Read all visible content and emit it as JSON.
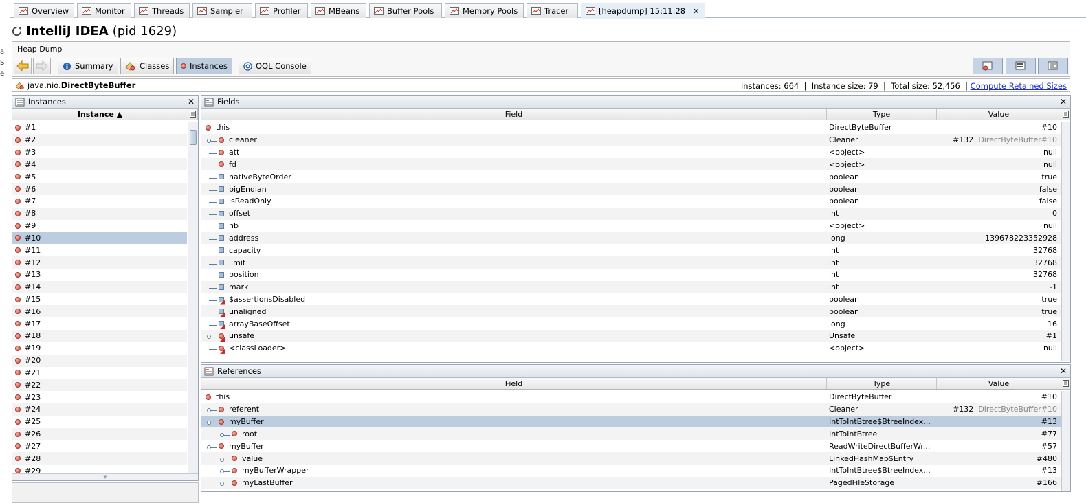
{
  "tabs": [
    {
      "label": "Overview",
      "icon": "overview-icon"
    },
    {
      "label": "Monitor",
      "icon": "monitor-icon"
    },
    {
      "label": "Threads",
      "icon": "threads-icon"
    },
    {
      "label": "Sampler",
      "icon": "sampler-icon"
    },
    {
      "label": "Profiler",
      "icon": "profiler-icon"
    },
    {
      "label": "MBeans",
      "icon": "mbeans-icon"
    },
    {
      "label": "Buffer Pools",
      "icon": "buffer-pools-icon"
    },
    {
      "label": "Memory Pools",
      "icon": "memory-pools-icon"
    },
    {
      "label": "Tracer",
      "icon": "tracer-icon"
    },
    {
      "label": "[heapdump] 15:11:28",
      "icon": "heapdump-icon",
      "active": true
    }
  ],
  "left_strip": [
    "a",
    "S",
    "e"
  ],
  "app": {
    "name": "IntelliJ IDEA",
    "pid": "(pid 1629)"
  },
  "heapdump_label": "Heap Dump",
  "views": [
    {
      "label": "Summary",
      "icon": "info-icon"
    },
    {
      "label": "Classes",
      "icon": "classes-icon"
    },
    {
      "label": "Instances",
      "icon": "instance-icon",
      "active": true
    },
    {
      "label": "OQL Console",
      "icon": "oql-icon"
    }
  ],
  "class_bar": {
    "package": "java.nio.",
    "class": "DirectByteBuffer",
    "stats": "Instances: 664  |  Instance size: 79  |  Total size: 52,456  |",
    "link": "Compute Retained Sizes"
  },
  "instances_panel": {
    "title": "Instances",
    "column": "Instance ▲",
    "items": [
      "#1",
      "#2",
      "#3",
      "#4",
      "#5",
      "#6",
      "#7",
      "#8",
      "#9",
      "#10",
      "#11",
      "#12",
      "#13",
      "#14",
      "#15",
      "#16",
      "#17",
      "#18",
      "#19",
      "#20",
      "#21",
      "#22",
      "#23",
      "#24",
      "#25",
      "#26",
      "#27",
      "#28",
      "#29"
    ],
    "selected_index": 9
  },
  "fields_panel": {
    "title": "Fields",
    "columns": [
      "Field",
      "Type",
      "Value"
    ],
    "rows": [
      {
        "name": "this",
        "type": "DirectByteBuffer",
        "value": "#10",
        "icon": "dot",
        "indent": 0
      },
      {
        "name": "cleaner",
        "type": "Cleaner",
        "value": "#132",
        "value_extra": "DirectByteBuffer#10",
        "icon": "dot",
        "indent": 1,
        "expand": true
      },
      {
        "name": "att",
        "type": "<object>",
        "value": "null",
        "icon": "dot",
        "indent": 1
      },
      {
        "name": "fd",
        "type": "<object>",
        "value": "null",
        "icon": "dot",
        "indent": 1
      },
      {
        "name": "nativeByteOrder",
        "type": "boolean",
        "value": "true",
        "icon": "sq",
        "indent": 1
      },
      {
        "name": "bigEndian",
        "type": "boolean",
        "value": "false",
        "icon": "sq",
        "indent": 1
      },
      {
        "name": "isReadOnly",
        "type": "boolean",
        "value": "false",
        "icon": "sq",
        "indent": 1
      },
      {
        "name": "offset",
        "type": "int",
        "value": "0",
        "icon": "sq",
        "indent": 1
      },
      {
        "name": "hb",
        "type": "<object>",
        "value": "null",
        "icon": "sq",
        "indent": 1
      },
      {
        "name": "address",
        "type": "long",
        "value": "139678223352928",
        "icon": "sq",
        "indent": 1
      },
      {
        "name": "capacity",
        "type": "int",
        "value": "32768",
        "icon": "sq",
        "indent": 1
      },
      {
        "name": "limit",
        "type": "int",
        "value": "32768",
        "icon": "sq",
        "indent": 1
      },
      {
        "name": "position",
        "type": "int",
        "value": "32768",
        "icon": "sq",
        "indent": 1
      },
      {
        "name": "mark",
        "type": "int",
        "value": "-1",
        "icon": "sq",
        "indent": 1
      },
      {
        "name": "$assertionsDisabled",
        "type": "boolean",
        "value": "true",
        "icon": "sq-static",
        "indent": 1
      },
      {
        "name": "unaligned",
        "type": "boolean",
        "value": "true",
        "icon": "sq-static",
        "indent": 1
      },
      {
        "name": "arrayBaseOffset",
        "type": "long",
        "value": "16",
        "icon": "sq-static",
        "indent": 1
      },
      {
        "name": "unsafe",
        "type": "Unsafe",
        "value": "#1",
        "icon": "dot-static",
        "indent": 1,
        "expand": true
      },
      {
        "name": "<classLoader>",
        "type": "<object>",
        "value": "null",
        "icon": "dot-static",
        "indent": 1
      }
    ]
  },
  "references_panel": {
    "title": "References",
    "columns": [
      "Field",
      "Type",
      "Value"
    ],
    "rows": [
      {
        "name": "this",
        "type": "DirectByteBuffer",
        "value": "#10",
        "indent": 0
      },
      {
        "name": "referent",
        "type": "Cleaner",
        "value": "#132",
        "value_extra": "DirectByteBuffer#10",
        "indent": 1,
        "expand": true
      },
      {
        "name": "myBuffer",
        "type": "IntToIntBtree$BtreeIndex...",
        "value": "#13",
        "indent": 1,
        "expand": true,
        "expanded": true,
        "selected": true
      },
      {
        "name": "root",
        "type": "IntToIntBtree",
        "value": "#77",
        "indent": 2,
        "expand": true
      },
      {
        "name": "myBuffer",
        "type": "ReadWriteDirectBufferWr...",
        "value": "#57",
        "indent": 1,
        "expand": true,
        "expanded": true
      },
      {
        "name": "value",
        "type": "LinkedHashMap$Entry",
        "value": "#480",
        "indent": 2,
        "expand": true
      },
      {
        "name": "myBufferWrapper",
        "type": "IntToIntBtree$BtreeIndex...",
        "value": "#13",
        "indent": 2,
        "expand": true
      },
      {
        "name": "myLastBuffer",
        "type": "PagedFileStorage",
        "value": "#166",
        "indent": 2,
        "expand": true
      }
    ]
  }
}
